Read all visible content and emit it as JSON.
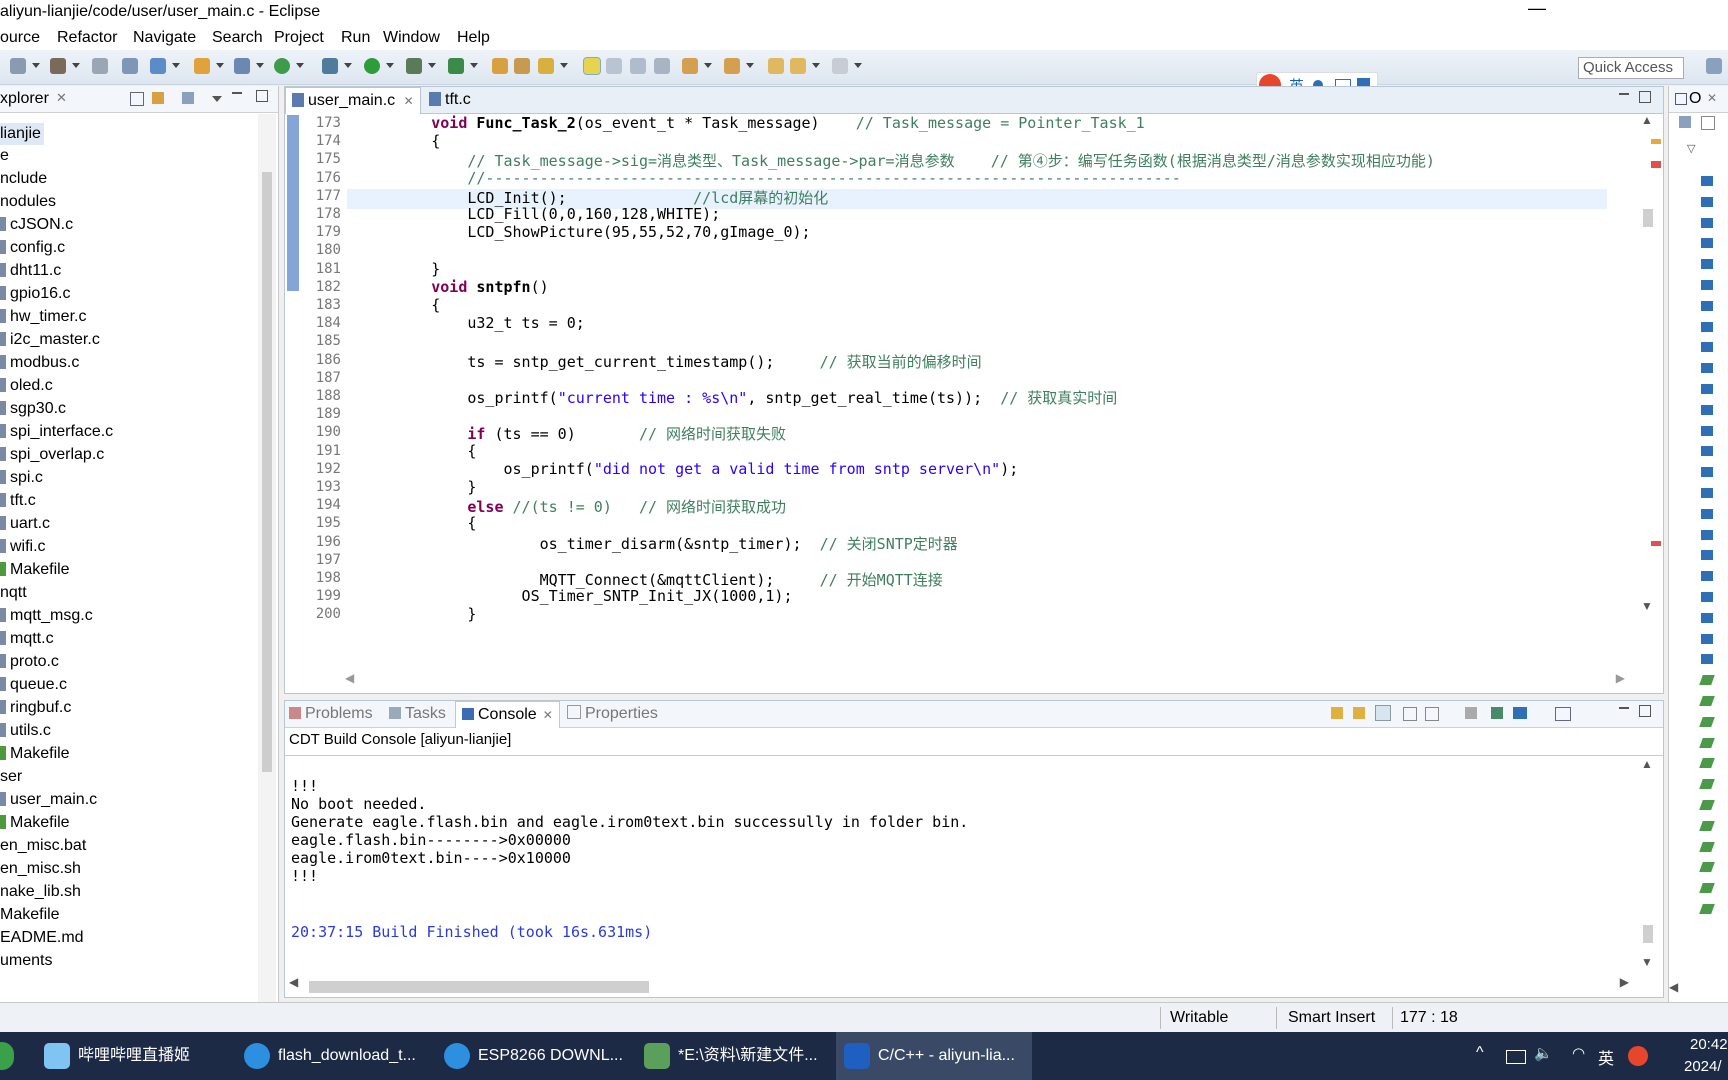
{
  "window": {
    "title": "aliyun-lianjie/code/user/user_main.c - Eclipse",
    "minimize_symbol": "—"
  },
  "menu": [
    "ource",
    "Refactor",
    "Navigate",
    "Search",
    "Project",
    "Run",
    "Window",
    "Help"
  ],
  "toolbar": {
    "quick_access": "Quick Access"
  },
  "ime": {
    "label": "英"
  },
  "explorer": {
    "tab_label": "xplorer",
    "project": "lianjie",
    "items": [
      {
        "label": "e",
        "indent": 0,
        "icon": "folder"
      },
      {
        "label": "nclude",
        "indent": 0,
        "icon": "folder"
      },
      {
        "label": "nodules",
        "indent": 0,
        "icon": "folder"
      },
      {
        "label": "cJSON.c",
        "indent": 1,
        "icon": "file"
      },
      {
        "label": "config.c",
        "indent": 1,
        "icon": "file"
      },
      {
        "label": "dht11.c",
        "indent": 1,
        "icon": "file"
      },
      {
        "label": "gpio16.c",
        "indent": 1,
        "icon": "file"
      },
      {
        "label": "hw_timer.c",
        "indent": 1,
        "icon": "file"
      },
      {
        "label": "i2c_master.c",
        "indent": 1,
        "icon": "file"
      },
      {
        "label": "modbus.c",
        "indent": 1,
        "icon": "file"
      },
      {
        "label": "oled.c",
        "indent": 1,
        "icon": "file"
      },
      {
        "label": "sgp30.c",
        "indent": 1,
        "icon": "file"
      },
      {
        "label": "spi_interface.c",
        "indent": 1,
        "icon": "file"
      },
      {
        "label": "spi_overlap.c",
        "indent": 1,
        "icon": "file"
      },
      {
        "label": "spi.c",
        "indent": 1,
        "icon": "file"
      },
      {
        "label": "tft.c",
        "indent": 1,
        "icon": "file"
      },
      {
        "label": "uart.c",
        "indent": 1,
        "icon": "file"
      },
      {
        "label": "wifi.c",
        "indent": 1,
        "icon": "file"
      },
      {
        "label": "Makefile",
        "indent": 1,
        "icon": "makefile"
      },
      {
        "label": "nqtt",
        "indent": 0,
        "icon": "folder"
      },
      {
        "label": "mqtt_msg.c",
        "indent": 1,
        "icon": "file"
      },
      {
        "label": "mqtt.c",
        "indent": 1,
        "icon": "file"
      },
      {
        "label": "proto.c",
        "indent": 1,
        "icon": "file"
      },
      {
        "label": "queue.c",
        "indent": 1,
        "icon": "file"
      },
      {
        "label": "ringbuf.c",
        "indent": 1,
        "icon": "file"
      },
      {
        "label": "utils.c",
        "indent": 1,
        "icon": "file"
      },
      {
        "label": "Makefile",
        "indent": 1,
        "icon": "makefile"
      },
      {
        "label": "ser",
        "indent": 0,
        "icon": "folder"
      },
      {
        "label": "user_main.c",
        "indent": 1,
        "icon": "file"
      },
      {
        "label": "Makefile",
        "indent": 1,
        "icon": "makefile"
      },
      {
        "label": "en_misc.bat",
        "indent": 0,
        "icon": "none"
      },
      {
        "label": "en_misc.sh",
        "indent": 0,
        "icon": "none"
      },
      {
        "label": "nake_lib.sh",
        "indent": 0,
        "icon": "none"
      },
      {
        "label": "Makefile",
        "indent": 0,
        "icon": "none"
      },
      {
        "label": "EADME.md",
        "indent": 0,
        "icon": "none"
      },
      {
        "label": "uments",
        "indent": 0,
        "icon": "none"
      }
    ]
  },
  "editor": {
    "tabs": [
      {
        "label": "user_main.c",
        "active": true
      },
      {
        "label": "tft.c",
        "active": false
      }
    ],
    "lines": [
      {
        "n": "173",
        "code": "        void Func_Task_2(os_event_t * Task_message)    // Task_message = Pointer_Task_1"
      },
      {
        "n": "174",
        "code": "        {"
      },
      {
        "n": "175",
        "code": "            // Task_message->sig=消息类型、Task_message->par=消息参数    // 第④步：编写任务函数(根据消息类型/消息参数实现相应功能)"
      },
      {
        "n": "176",
        "code": "            //-----------------------------------------------------------------------------"
      },
      {
        "n": "177",
        "code": "            LCD_Init();              //lcd屏幕的初始化"
      },
      {
        "n": "178",
        "code": "            LCD_Fill(0,0,160,128,WHITE);"
      },
      {
        "n": "179",
        "code": "            LCD_ShowPicture(95,55,52,70,gImage_0);"
      },
      {
        "n": "180",
        "code": ""
      },
      {
        "n": "181",
        "code": "        }"
      },
      {
        "n": "182",
        "code": "        void sntpfn()"
      },
      {
        "n": "183",
        "code": "        {"
      },
      {
        "n": "184",
        "code": "            u32_t ts = 0;"
      },
      {
        "n": "185",
        "code": ""
      },
      {
        "n": "186",
        "code": "            ts = sntp_get_current_timestamp();     // 获取当前的偏移时间"
      },
      {
        "n": "187",
        "code": ""
      },
      {
        "n": "188",
        "code": "            os_printf(\"current time : %s\\n\", sntp_get_real_time(ts));  // 获取真实时间"
      },
      {
        "n": "189",
        "code": ""
      },
      {
        "n": "190",
        "code": "            if (ts == 0)       // 网络时间获取失败"
      },
      {
        "n": "191",
        "code": "            {"
      },
      {
        "n": "192",
        "code": "                os_printf(\"did not get a valid time from sntp server\\n\");"
      },
      {
        "n": "193",
        "code": "            }"
      },
      {
        "n": "194",
        "code": "            else //(ts != 0)   // 网络时间获取成功"
      },
      {
        "n": "195",
        "code": "            {"
      },
      {
        "n": "196",
        "code": "                    os_timer_disarm(&sntp_timer);  // 关闭SNTP定时器"
      },
      {
        "n": "197",
        "code": ""
      },
      {
        "n": "198",
        "code": "                    MQTT_Connect(&mqttClient);     // 开始MQTT连接"
      },
      {
        "n": "199",
        "code": "                  OS_Timer_SNTP_Init_JX(1000,1);"
      },
      {
        "n": "200",
        "code": "            }"
      }
    ]
  },
  "console": {
    "tabs": [
      "Problems",
      "Tasks",
      "Console",
      "Properties"
    ],
    "header": "CDT Build Console [aliyun-lianjie]",
    "lines": [
      "!!!",
      "No boot needed.",
      "Generate eagle.flash.bin and eagle.irom0text.bin successully in folder bin.",
      "eagle.flash.bin-------->0x00000",
      "eagle.irom0text.bin---->0x10000",
      "!!!"
    ],
    "finished": "20:37:15 Build Finished (took 16s.631ms)"
  },
  "outline": {
    "tab_label": "O"
  },
  "statusbar": {
    "writable": "Writable",
    "insert_mode": "Smart Insert",
    "position": "177 : 18"
  },
  "taskbar": {
    "items": [
      {
        "label": "哔哩哔哩直播姬",
        "color": "#7fc4f2"
      },
      {
        "label": "flash_download_t...",
        "color": "#2c8fe0"
      },
      {
        "label": "ESP8266 DOWNL...",
        "color": "#2c8fe0"
      },
      {
        "label": "*E:\\资料\\新建文件...",
        "color": "#5aa05a"
      },
      {
        "label": "C/C++ - aliyun-lia...",
        "color": "#1f5fbf"
      }
    ],
    "tray_lang": "英",
    "time": "20:42",
    "date": "2024/"
  }
}
